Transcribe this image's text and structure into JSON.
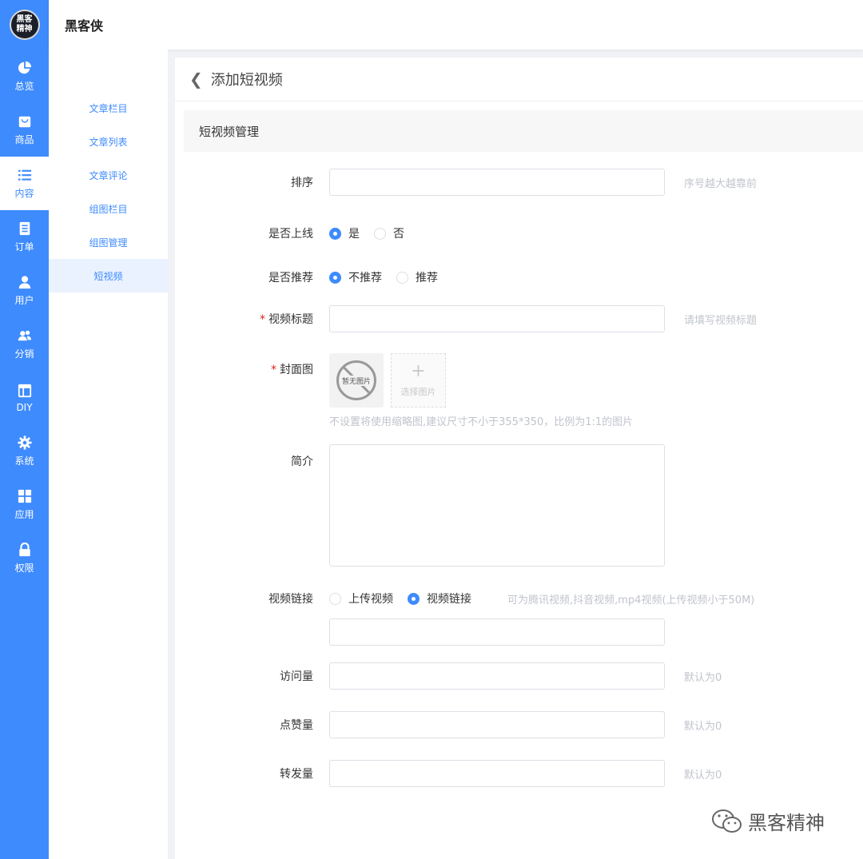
{
  "rail": {
    "logo_line1": "黑客",
    "logo_line2": "精神",
    "items": [
      {
        "label": "总览",
        "icon": "pie-chart-icon"
      },
      {
        "label": "商品",
        "icon": "shopping-bag-icon"
      },
      {
        "label": "内容",
        "icon": "list-icon"
      },
      {
        "label": "订单",
        "icon": "document-icon"
      },
      {
        "label": "用户",
        "icon": "user-icon"
      },
      {
        "label": "分销",
        "icon": "users-icon"
      },
      {
        "label": "DIY",
        "icon": "layout-icon"
      },
      {
        "label": "系统",
        "icon": "gear-icon"
      },
      {
        "label": "应用",
        "icon": "grid-icon"
      },
      {
        "label": "权限",
        "icon": "lock-icon"
      }
    ]
  },
  "header": {
    "brand": "黑客侠"
  },
  "subnav": {
    "items": [
      {
        "label": "文章栏目"
      },
      {
        "label": "文章列表"
      },
      {
        "label": "文章评论"
      },
      {
        "label": "组图栏目"
      },
      {
        "label": "组图管理"
      },
      {
        "label": "短视频"
      }
    ]
  },
  "page": {
    "title": "添加短视频",
    "section": "短视频管理"
  },
  "form": {
    "sort": {
      "label": "排序",
      "hint": "序号越大越靠前"
    },
    "online": {
      "label": "是否上线",
      "opt_yes": "是",
      "opt_no": "否"
    },
    "recommend": {
      "label": "是否推荐",
      "opt_no": "不推荐",
      "opt_yes": "推荐"
    },
    "title": {
      "label": "视频标题",
      "hint": "请填写视频标题"
    },
    "cover": {
      "label": "封面图",
      "placeholder_text": "暂无图片",
      "pick_text": "选择图片",
      "tip": "不设置将使用缩略图,建议尺寸不小于355*350，比例为1:1的图片"
    },
    "intro": {
      "label": "简介"
    },
    "video": {
      "label": "视频链接",
      "opt_upload": "上传视频",
      "opt_link": "视频链接",
      "hint": "可为腾讯视频,抖音视频,mp4视频(上传视频小于50M)"
    },
    "visits": {
      "label": "访问量",
      "hint": "默认为0"
    },
    "likes": {
      "label": "点赞量",
      "hint": "默认为0"
    },
    "shares": {
      "label": "转发量",
      "hint": "默认为0"
    }
  },
  "watermark": {
    "text": "黑客精神"
  },
  "colors": {
    "primary": "#3e8bfd",
    "hint": "#c0c4cc",
    "required": "#e02020"
  }
}
